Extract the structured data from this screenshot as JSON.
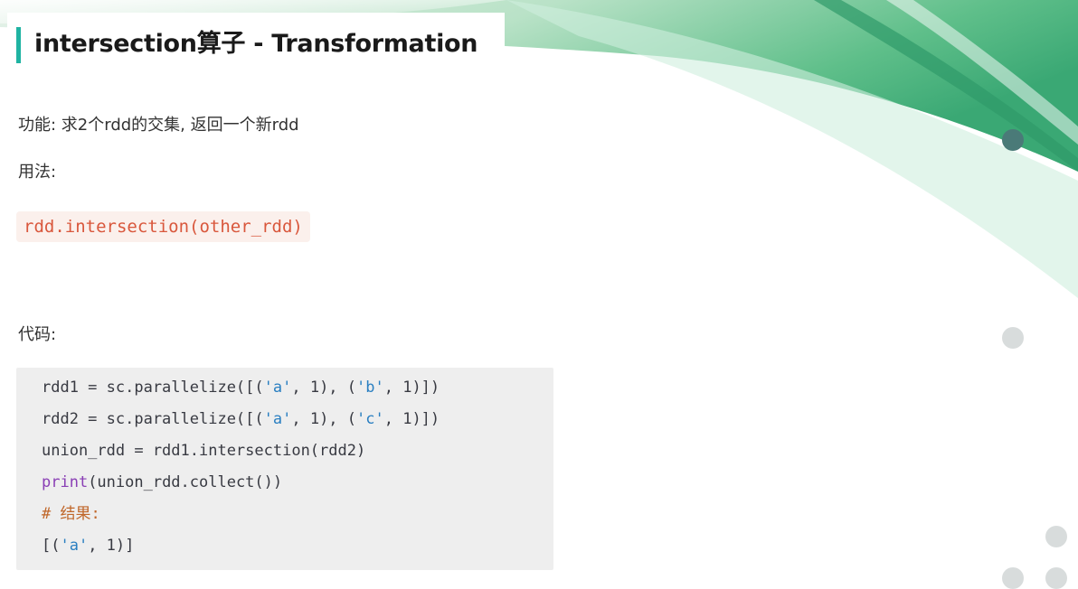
{
  "title": "intersection算子 - Transformation",
  "description": "功能: 求2个rdd的交集, 返回一个新rdd",
  "usage": {
    "label": "用法:",
    "code": "rdd.intersection(other_rdd)"
  },
  "code_section": {
    "label": "代码:",
    "lines": [
      "rdd1 = sc.parallelize([('a', 1), ('b', 1)])",
      "rdd2 = sc.parallelize([('a', 1), ('c', 1)])",
      "union_rdd = rdd1.intersection(rdd2)",
      "print(union_rdd.collect())",
      "# 结果:",
      "[('a', 1)]"
    ]
  },
  "colors": {
    "accent": "#1fb3a2",
    "inline_code_text": "#d9573c",
    "inline_code_bg": "#fbf0ec",
    "code_bg": "#eeeeee",
    "string": "#2a7fc1",
    "keyword": "#8a3fb5",
    "comment": "#c0672a",
    "dot_dark": "#4a7a78",
    "dot_light": "#d8dcdc"
  }
}
